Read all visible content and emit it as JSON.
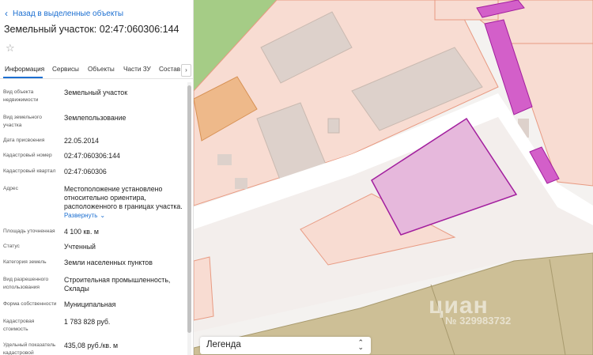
{
  "panel": {
    "back_label": "Назад в выделенные объекты",
    "title": "Земельный участок: 02:47:060306:144",
    "tabs": [
      {
        "label": "Информация"
      },
      {
        "label": "Сервисы"
      },
      {
        "label": "Объекты"
      },
      {
        "label": "Части ЗУ"
      },
      {
        "label": "Состав"
      }
    ],
    "tab_scroll_icon": "›",
    "rows": [
      {
        "label": "Вид объекта недвижимости",
        "value": "Земельный участок"
      },
      {
        "label": "Вид земельного участка",
        "value": "Землепользование"
      },
      {
        "label": "Дата присвоения",
        "value": "22.05.2014"
      },
      {
        "label": "Кадастровый номер",
        "value": "02:47:060306:144"
      },
      {
        "label": "Кадастровый квартал",
        "value": "02:47:060306"
      },
      {
        "label": "Адрес",
        "value": "Местоположение установлено относительно ориентира, расположенного в границах участка."
      },
      {
        "label": "Площадь уточненная",
        "value": "4 100 кв. м"
      },
      {
        "label": "Статус",
        "value": "Учтенный"
      },
      {
        "label": "Категория земель",
        "value": "Земли населенных пунктов"
      },
      {
        "label": "Вид разрешенного использования",
        "value": "Строительная промышленность, Склады"
      },
      {
        "label": "Форма собственности",
        "value": "Муниципальная"
      },
      {
        "label": "Кадастровая стоимость",
        "value": "1 783 828 руб."
      },
      {
        "label": "Удельный показатель кадастровой",
        "value": "435,08 руб./кв. м"
      }
    ],
    "expand_label": "Развернуть"
  },
  "map": {
    "legend_label": "Легенда",
    "watermark": "циан",
    "watermark_id": "№ 329983732",
    "colors": {
      "parcel_fill": "#f8dcd2",
      "parcel_stroke": "#e89a82",
      "building": "#ddd1cb",
      "selected_fill": "#e6b8dc",
      "selected_stroke": "#a21e9e",
      "magenta": "#d35fc9",
      "green": "#a5cc86",
      "orange": "#eeb98a",
      "olive": "#cdbf96",
      "road": "#ffffff"
    }
  }
}
